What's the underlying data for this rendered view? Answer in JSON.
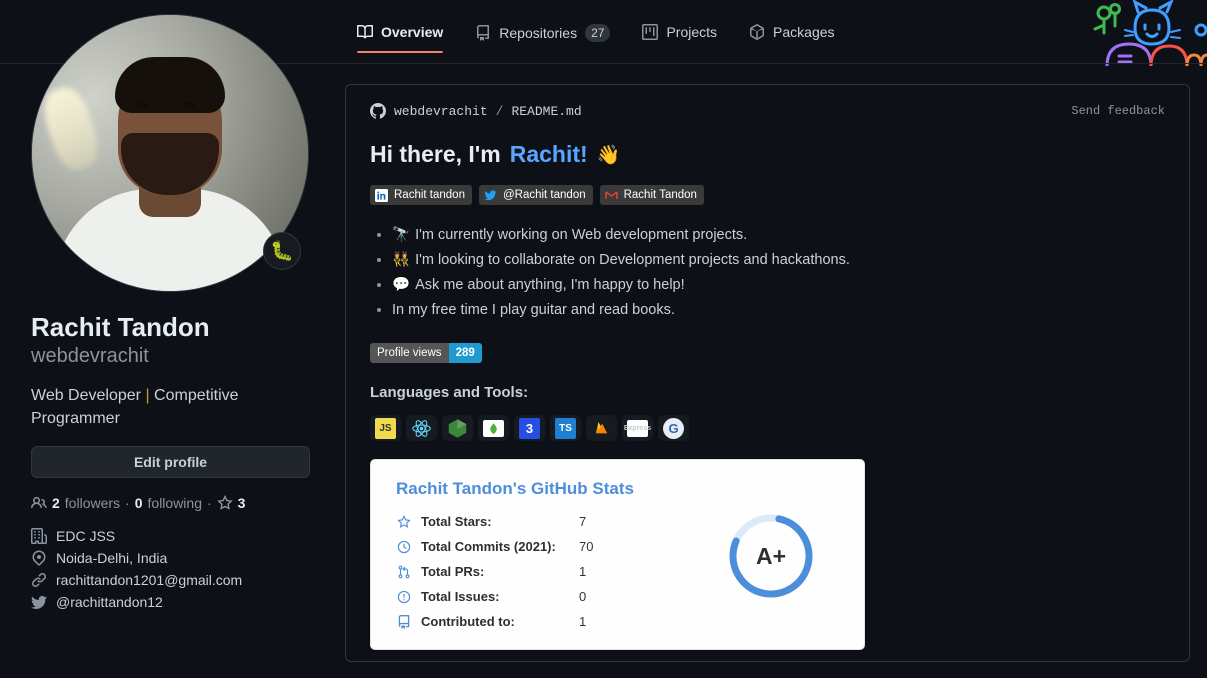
{
  "nav": {
    "tabs": [
      {
        "label": "Overview",
        "icon": "book-icon",
        "count": null,
        "active": true
      },
      {
        "label": "Repositories",
        "icon": "repo-icon",
        "count": "27",
        "active": false
      },
      {
        "label": "Projects",
        "icon": "project-icon",
        "count": null,
        "active": false
      },
      {
        "label": "Packages",
        "icon": "package-icon",
        "count": null,
        "active": false
      }
    ]
  },
  "sidebar": {
    "avatar_status_emoji": "🐛",
    "name": "Rachit Tandon",
    "login": "webdevrachit",
    "bio_before": "Web Developer ",
    "bio_pipe": "|",
    "bio_after": " Competitive Programmer",
    "edit_profile_label": "Edit profile",
    "followers_count": "2",
    "followers_label": "followers",
    "following_count": "0",
    "following_label": "following",
    "stars_count": "3",
    "separator": "·",
    "meta": [
      {
        "icon": "organization-icon",
        "text": "EDC JSS"
      },
      {
        "icon": "location-icon",
        "text": "Noida-Delhi, India"
      },
      {
        "icon": "link-icon",
        "text": "rachittandon1201@gmail.com"
      },
      {
        "icon": "twitter-icon",
        "text": "@rachittandon12"
      }
    ]
  },
  "readme": {
    "owner": "webdevrachit",
    "separator": "/",
    "filename": "README.md",
    "send_feedback": "Send feedback",
    "title_prefix": "Hi there, I'm ",
    "title_highlight": "Rachit!",
    "title_emoji": "👋",
    "social_badges": [
      {
        "icon": "linkedin-icon",
        "label": "Rachit tandon"
      },
      {
        "icon": "twitter-icon",
        "label": "@Rachit tandon"
      },
      {
        "icon": "gmail-icon",
        "label": "Rachit Tandon"
      }
    ],
    "bullets": [
      {
        "emoji": "🔭",
        "text": "I'm currently working on Web development projects."
      },
      {
        "emoji": "👯",
        "text": "I'm looking to collaborate on Development projects and hackathons."
      },
      {
        "emoji": "💬",
        "text": "Ask me about anything, I'm happy to help!"
      },
      {
        "emoji": "",
        "text": "In my free time I play guitar and read books."
      }
    ],
    "profile_views_label": "Profile views",
    "profile_views_count": "289",
    "languages_title": "Languages and Tools:",
    "tools": [
      {
        "name": "javascript-icon",
        "text": "JS",
        "bg": "#f0db4f",
        "fg": "#323330"
      },
      {
        "name": "react-icon",
        "text": "",
        "bg": "#20232a",
        "fg": "#61dafb"
      },
      {
        "name": "nodejs-icon",
        "text": "",
        "bg": "#3c873a",
        "fg": "#83cd29"
      },
      {
        "name": "mongodb-icon",
        "text": "",
        "bg": "#ffffff",
        "fg": "#4db33d"
      },
      {
        "name": "css3-icon",
        "text": "3",
        "bg": "#264de4",
        "fg": "#ffffff"
      },
      {
        "name": "typescript-icon",
        "text": "TS",
        "bg": "#1f7fd0",
        "fg": "#ffffff"
      },
      {
        "name": "firebase-icon",
        "text": "",
        "bg": "#161b22",
        "fg": "#ffa000"
      },
      {
        "name": "express-icon",
        "text": "",
        "bg": "#ffffff",
        "fg": "#c9c9c9"
      },
      {
        "name": "gitkraken-icon",
        "text": "G",
        "bg": "#e9eef5",
        "fg": "#2b6cb8"
      }
    ]
  },
  "stats": {
    "title": "Rachit Tandon's GitHub Stats",
    "rows": [
      {
        "icon": "star-icon",
        "label": "Total Stars:",
        "value": "7"
      },
      {
        "icon": "clock-icon",
        "label": "Total Commits (2021):",
        "value": "70"
      },
      {
        "icon": "pr-icon",
        "label": "Total PRs:",
        "value": "1"
      },
      {
        "icon": "issue-icon",
        "label": "Total Issues:",
        "value": "0"
      },
      {
        "icon": "repo-icon",
        "label": "Contributed to:",
        "value": "1"
      }
    ],
    "grade": "A+",
    "ring_percent": 78,
    "ring_color": "#4c8eda",
    "ring_track_color": "#dce9f9"
  },
  "chart_data": {
    "type": "bar",
    "title": "Rachit Tandon's GitHub Stats",
    "categories": [
      "Total Stars",
      "Total Commits (2021)",
      "Total PRs",
      "Total Issues",
      "Contributed to"
    ],
    "values": [
      7,
      70,
      1,
      0,
      1
    ],
    "annotations": [
      "Grade: A+"
    ],
    "xlabel": "",
    "ylabel": ""
  }
}
